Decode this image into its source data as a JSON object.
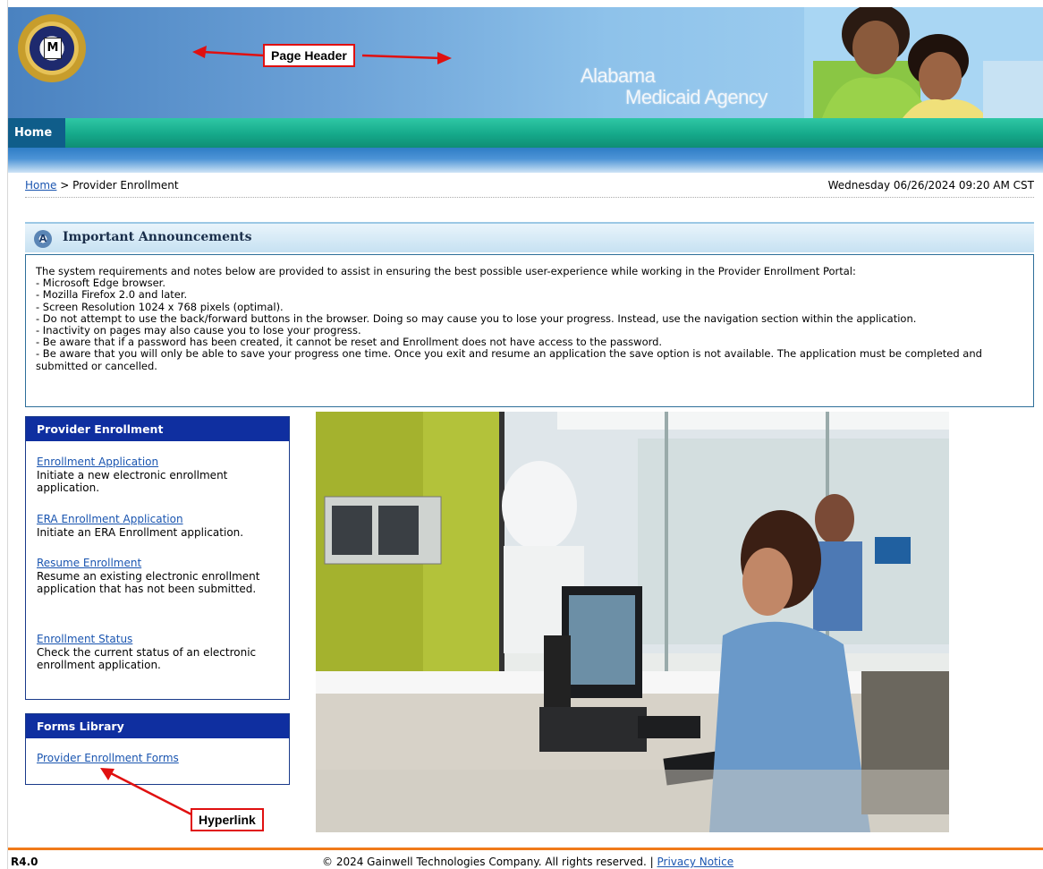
{
  "header": {
    "callout": "Page Header",
    "agency_line1": "Alabama",
    "agency_line2": "Medicaid Agency",
    "seal_letter": "M"
  },
  "nav": {
    "home": "Home"
  },
  "breadcrumb": {
    "home": "Home",
    "separator": " > ",
    "current": "Provider Enrollment",
    "datetime": "Wednesday 06/26/2024 09:20 AM CST"
  },
  "announcements": {
    "title": "Important Announcements",
    "lines": [
      "The system requirements and notes below are provided to assist in ensuring the best possible user-experience while working in the Provider Enrollment Portal:",
      "- Microsoft Edge browser.",
      "- Mozilla Firefox 2.0 and later.",
      "- Screen Resolution 1024 x 768 pixels (optimal).",
      "- Do not attempt to use the back/forward buttons in the browser. Doing so may cause you to lose your progress. Instead, use the navigation section within the application.",
      "- Inactivity on pages may also cause you to lose your progress.",
      "- Be aware that if a password has been created, it cannot be reset and Enrollment does not have access to the password.",
      "- Be aware that you will only be able to save your progress one time. Once you exit and resume an application the save option is not available. The application must be completed and submitted or cancelled."
    ]
  },
  "provider_enrollment": {
    "title": "Provider Enrollment",
    "items": [
      {
        "link": "Enrollment Application",
        "desc": "Initiate a new electronic enrollment application."
      },
      {
        "link": "ERA Enrollment Application",
        "desc": "Initiate an ERA Enrollment application."
      },
      {
        "link": "Resume Enrollment",
        "desc": "Resume an existing electronic enrollment application that has not been submitted."
      },
      {
        "link": "Enrollment Status",
        "desc": "Check the current status of an electronic enrollment application."
      }
    ]
  },
  "forms_library": {
    "title": "Forms Library",
    "link": "Provider Enrollment Forms",
    "callout": "Hyperlink"
  },
  "footer": {
    "version": "R4.0",
    "copyright": "© 2024 Gainwell Technologies Company. All rights reserved.",
    "separator": " | ",
    "privacy": "Privacy Notice"
  },
  "colors": {
    "nav_green": "#15a98a",
    "box_header_blue": "#0f2fa0",
    "link_blue": "#1a55b0",
    "callout_red": "#e01010",
    "footer_orange": "#f07a1a"
  }
}
